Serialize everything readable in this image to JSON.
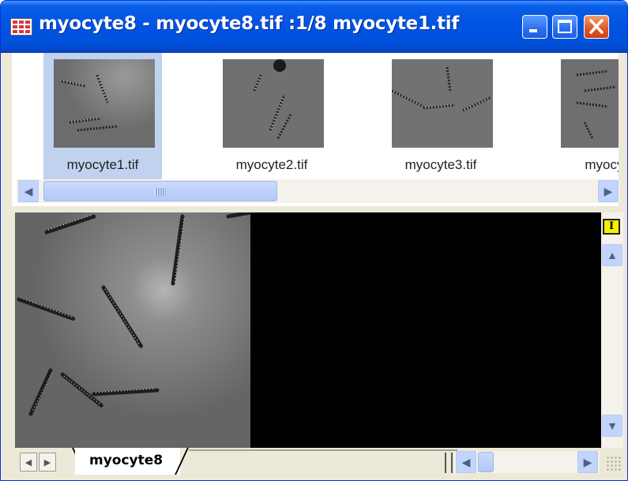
{
  "window": {
    "title": "myocyte8 - myocyte8.tif :1/8 myocyte1.tif",
    "controls": [
      "minimize-icon",
      "maximize-icon",
      "close-icon"
    ]
  },
  "thumbnails": [
    {
      "label": "myocyte1.tif",
      "selected": true
    },
    {
      "label": "myocyte2.tif",
      "selected": false
    },
    {
      "label": "myocyte3.tif",
      "selected": false
    },
    {
      "label": "myocyte",
      "selected": false
    }
  ],
  "toolbar": {
    "tool_label": "I"
  },
  "sheet_tabs": [
    {
      "label": "myocyte8",
      "active": true
    }
  ],
  "icons": {
    "scroll_left": "◀",
    "scroll_right": "▶",
    "scroll_up": "▲",
    "scroll_down": "▼",
    "nav_prev": "◀",
    "nav_next": "▶"
  },
  "colors": {
    "titlebar": "#0053e1",
    "selection": "#c1d2ee",
    "image_bg": "#000000",
    "tool_button": "#f4ee00"
  }
}
